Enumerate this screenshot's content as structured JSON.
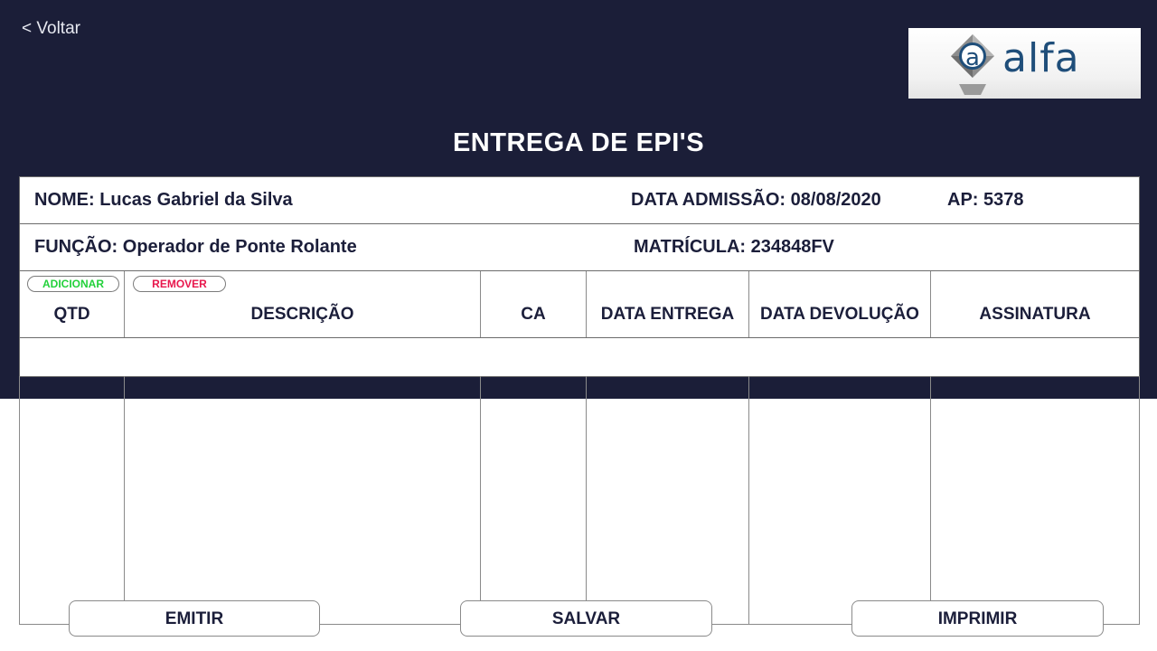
{
  "nav": {
    "back_label": "< Voltar"
  },
  "brand": {
    "logo_text": "alfa",
    "logo_letter": "a",
    "color": "#1f4e7a"
  },
  "page_title": "ENTREGA DE EPI'S",
  "employee": {
    "nome": "NOME: Lucas Gabriel da Silva",
    "data_admissao": "DATA ADMISSÃO: 08/08/2020",
    "ap": "AP: 5378",
    "funcao": "FUNÇÃO: Operador de Ponte Rolante",
    "matricula": "MATRÍCULA: 234848FV"
  },
  "table": {
    "add_label": "ADICIONAR",
    "remove_label": "REMOVER",
    "columns": [
      "QTD",
      "DESCRIÇÃO",
      "CA",
      "DATA ENTREGA",
      "DATA DEVOLUÇÃO",
      "ASSINATURA"
    ],
    "rows": []
  },
  "actions": {
    "emitir": "EMITIR",
    "salvar": "SALVAR",
    "imprimir": "IMPRIMIR"
  },
  "colors": {
    "header_bg": "#1b1e38",
    "add": "#22d13a",
    "remove": "#e8174c",
    "text": "#1b1e3a"
  }
}
